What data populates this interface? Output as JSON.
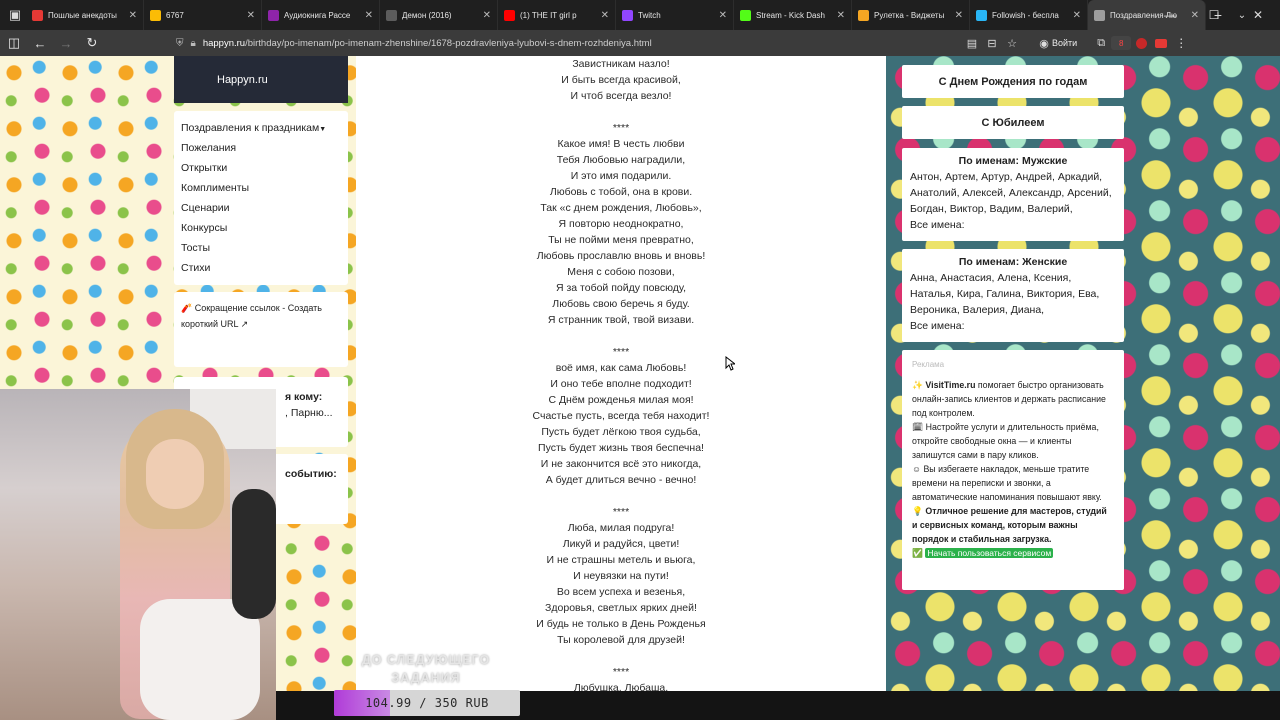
{
  "browser": {
    "tabs": [
      {
        "title": "Пошлые анекдоты",
        "color": "#e53935"
      },
      {
        "title": "6767",
        "color": "#fbbc05"
      },
      {
        "title": "Аудиокнига Рассе",
        "color": "#8e24aa"
      },
      {
        "title": "Демон (2016)",
        "color": "#5c5c5c"
      },
      {
        "title": "(1) THE IT girl p",
        "color": "#ff0000"
      },
      {
        "title": "Twitch",
        "color": "#9146ff"
      },
      {
        "title": "Stream - Kick Dash",
        "color": "#53fc18"
      },
      {
        "title": "Рулетка - Виджеты",
        "color": "#f5a623"
      },
      {
        "title": "Followish - беспла",
        "color": "#29b6f6"
      },
      {
        "title": "Поздравления Лю",
        "color": "#9e9e9e"
      }
    ],
    "url_host": "happyn.ru",
    "url_path": "/birthday/po-imenam/po-imenam-zhenshine/1678-pozdravleniya-lyubovi-s-dnem-rozhdeniya.html",
    "login_label": "Войти",
    "notif_count": "8"
  },
  "site": {
    "logo": "Happyn.ru",
    "menu": [
      "Поздравления к праздникам",
      "Пожелания",
      "Открытки",
      "Комплименты",
      "Сценарии",
      "Конкурсы",
      "Тосты",
      "Стихи"
    ],
    "promo": "🧨 Сокращение ссылок - Создать короткий URL ↗",
    "widget1_title": "я кому:",
    "widget1_text": ", Парню...",
    "widget2_title": "событию:"
  },
  "poems": [
    {
      "lines": [
        "Завистникам назло!",
        "И быть всегда красивой,",
        "И чтоб всегда везло!"
      ]
    },
    {
      "lines": [
        "Какое имя! В честь любви",
        "Тебя Любовью наградили,",
        "И это имя подарили.",
        "Любовь с тобой, она в крови.",
        "Так «с днем рождения, Любовь»,",
        "Я повторю неоднократно,",
        "Ты не пойми меня превратно,",
        "Любовь прославлю вновь и вновь!",
        "Меня с собою позови,",
        "Я за тобой пойду повсюду,",
        "Любовь свою беречь я буду.",
        "Я странник твой, твой визави."
      ]
    },
    {
      "lines": [
        "воё имя, как сама Любовь!",
        "И оно тебе вполне подходит!",
        "С Днём рожденья милая моя!",
        "Счастье пусть, всегда тебя находит!",
        "Пусть будет лёгкою твоя судьба,",
        "Пусть будет жизнь твоя беспечна!",
        "И не закончится всё это никогда,",
        "А будет длиться вечно - вечно!"
      ]
    },
    {
      "lines": [
        "Люба, милая подруга!",
        "Ликуй и радуйся, цвети!",
        "И не страшны метель и вьюга,",
        "И неувязки на пути!",
        "Во всем успеха и везенья,",
        "Здоровья, светлых ярких дней!",
        "И будь не только в День Рожденья",
        "Ты королевой для друзей!"
      ]
    },
    {
      "lines": [
        "Любушка, Любаша,"
      ]
    }
  ],
  "separator": "****",
  "sidebar": {
    "by_years": "С Днем Рождения по годам",
    "jubilee": "С Юбилеем",
    "male_title": "По именам: Мужские",
    "male_names": "Антон, Артем, Артур, Андрей, Аркадий, Анатолий, Алексей, Александр, Арсений, Богдан, Виктор, Вадим, Валерий,",
    "male_all": "Все имена:",
    "female_title": "По именам: Женские",
    "female_names": "Анна, Анастасия, Алена, Ксения, Наталья, Кира, Галина, Виктория, Ева, Вероника, Валерия, Диана,",
    "female_all": "Все имена:"
  },
  "ad": {
    "label": "Реклама",
    "brand": "VisitTime.ru",
    "p1": " помогает быстро организовать онлайн-запись клиентов и держать расписание под контролем.",
    "p2": "Настройте услуги и длительность приёма, откройте свободные окна — и клиенты запишутся сами в пару кликов.",
    "p3": "Вы избегаете накладок, меньше тратите времени на переписки и звонки, а автоматические напоминания повышают явку.",
    "p4": "Отличное решение для мастеров, студий и сервисных команд, которым важны порядок и стабильная загрузка.",
    "cta": "Начать пользоваться сервисом"
  },
  "stream": {
    "task_label": "ДО СЛЕДУЮЩЕГО ЗАДАНИЯ",
    "goal_text": "104.99 / 350 RUB",
    "goal_fraction": 0.3,
    "goal_color": "#b03bd8"
  }
}
